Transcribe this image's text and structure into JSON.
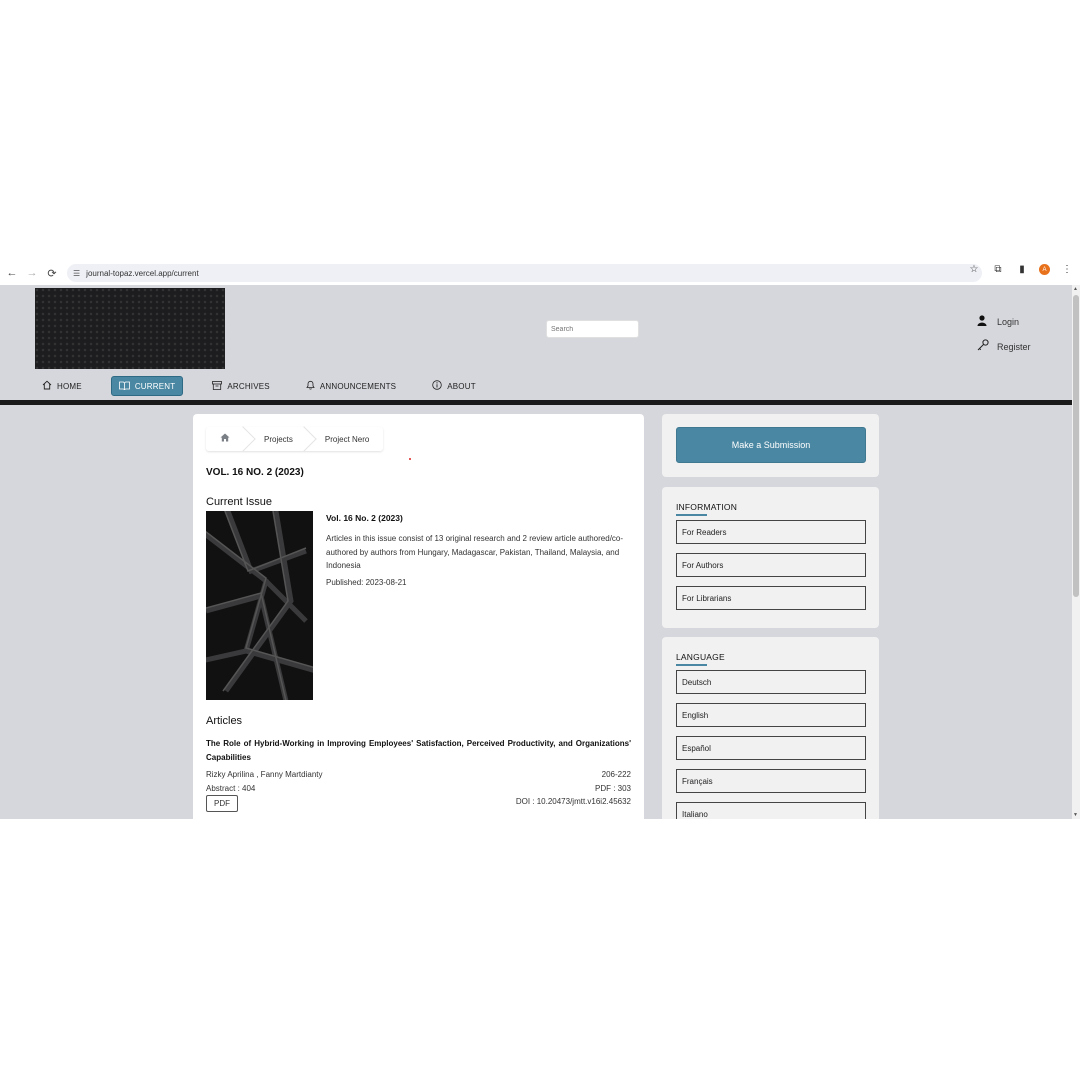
{
  "browser": {
    "url": "journal-topaz.vercel.app/current",
    "back": "←",
    "forward": "→",
    "reload": "⟳",
    "profile_initial": "A"
  },
  "header": {
    "search_placeholder": "Search",
    "login_label": "Login",
    "register_label": "Register"
  },
  "nav": {
    "items": [
      {
        "label": "HOME",
        "icon": "home-icon",
        "active": false
      },
      {
        "label": "CURRENT",
        "icon": "book-icon",
        "active": true
      },
      {
        "label": "ARCHIVES",
        "icon": "archive-icon",
        "active": false
      },
      {
        "label": "ANNOUNCEMENTS",
        "icon": "bell-icon",
        "active": false
      },
      {
        "label": "ABOUT",
        "icon": "info-icon",
        "active": false
      }
    ]
  },
  "breadcrumb": {
    "items": [
      "Projects",
      "Project Nero"
    ]
  },
  "main": {
    "volume_title": "VOL. 16 NO. 2 (2023)",
    "current_issue_heading": "Current Issue",
    "issue_title": "Vol. 16 No. 2 (2023)",
    "issue_description": "Articles in this issue consist of 13 original research and 2 review article authored/co-authored by authors from Hungary, Madagascar, Pakistan, Thailand, Malaysia, and Indonesia",
    "published": "Published: 2023-08-21",
    "articles_heading": "Articles"
  },
  "article": {
    "title": "The Role of Hybrid-Working in Improving Employees' Satisfaction, Perceived Productivity, and Organizations' Capabilities",
    "authors": "Rizky Aprilina , Fanny Martdianty",
    "abstract": "Abstract : 404",
    "pages": "206-222",
    "pdf_count": "PDF : 303",
    "doi": "DOI : 10.20473/jmtt.v16i2.45632",
    "pdf_button": "PDF"
  },
  "sidebar": {
    "submit_label": "Make a Submission",
    "information_heading": "INFORMATION",
    "information_links": [
      "For Readers",
      "For Authors",
      "For Librarians"
    ],
    "language_heading": "LANGUAGE",
    "languages": [
      "Deutsch",
      "English",
      "Español",
      "Français",
      "Italiano"
    ]
  },
  "colors": {
    "accent": "#4a87a2",
    "page_bg": "#d6d7dc",
    "nav_rule": "#1a1a1a"
  }
}
